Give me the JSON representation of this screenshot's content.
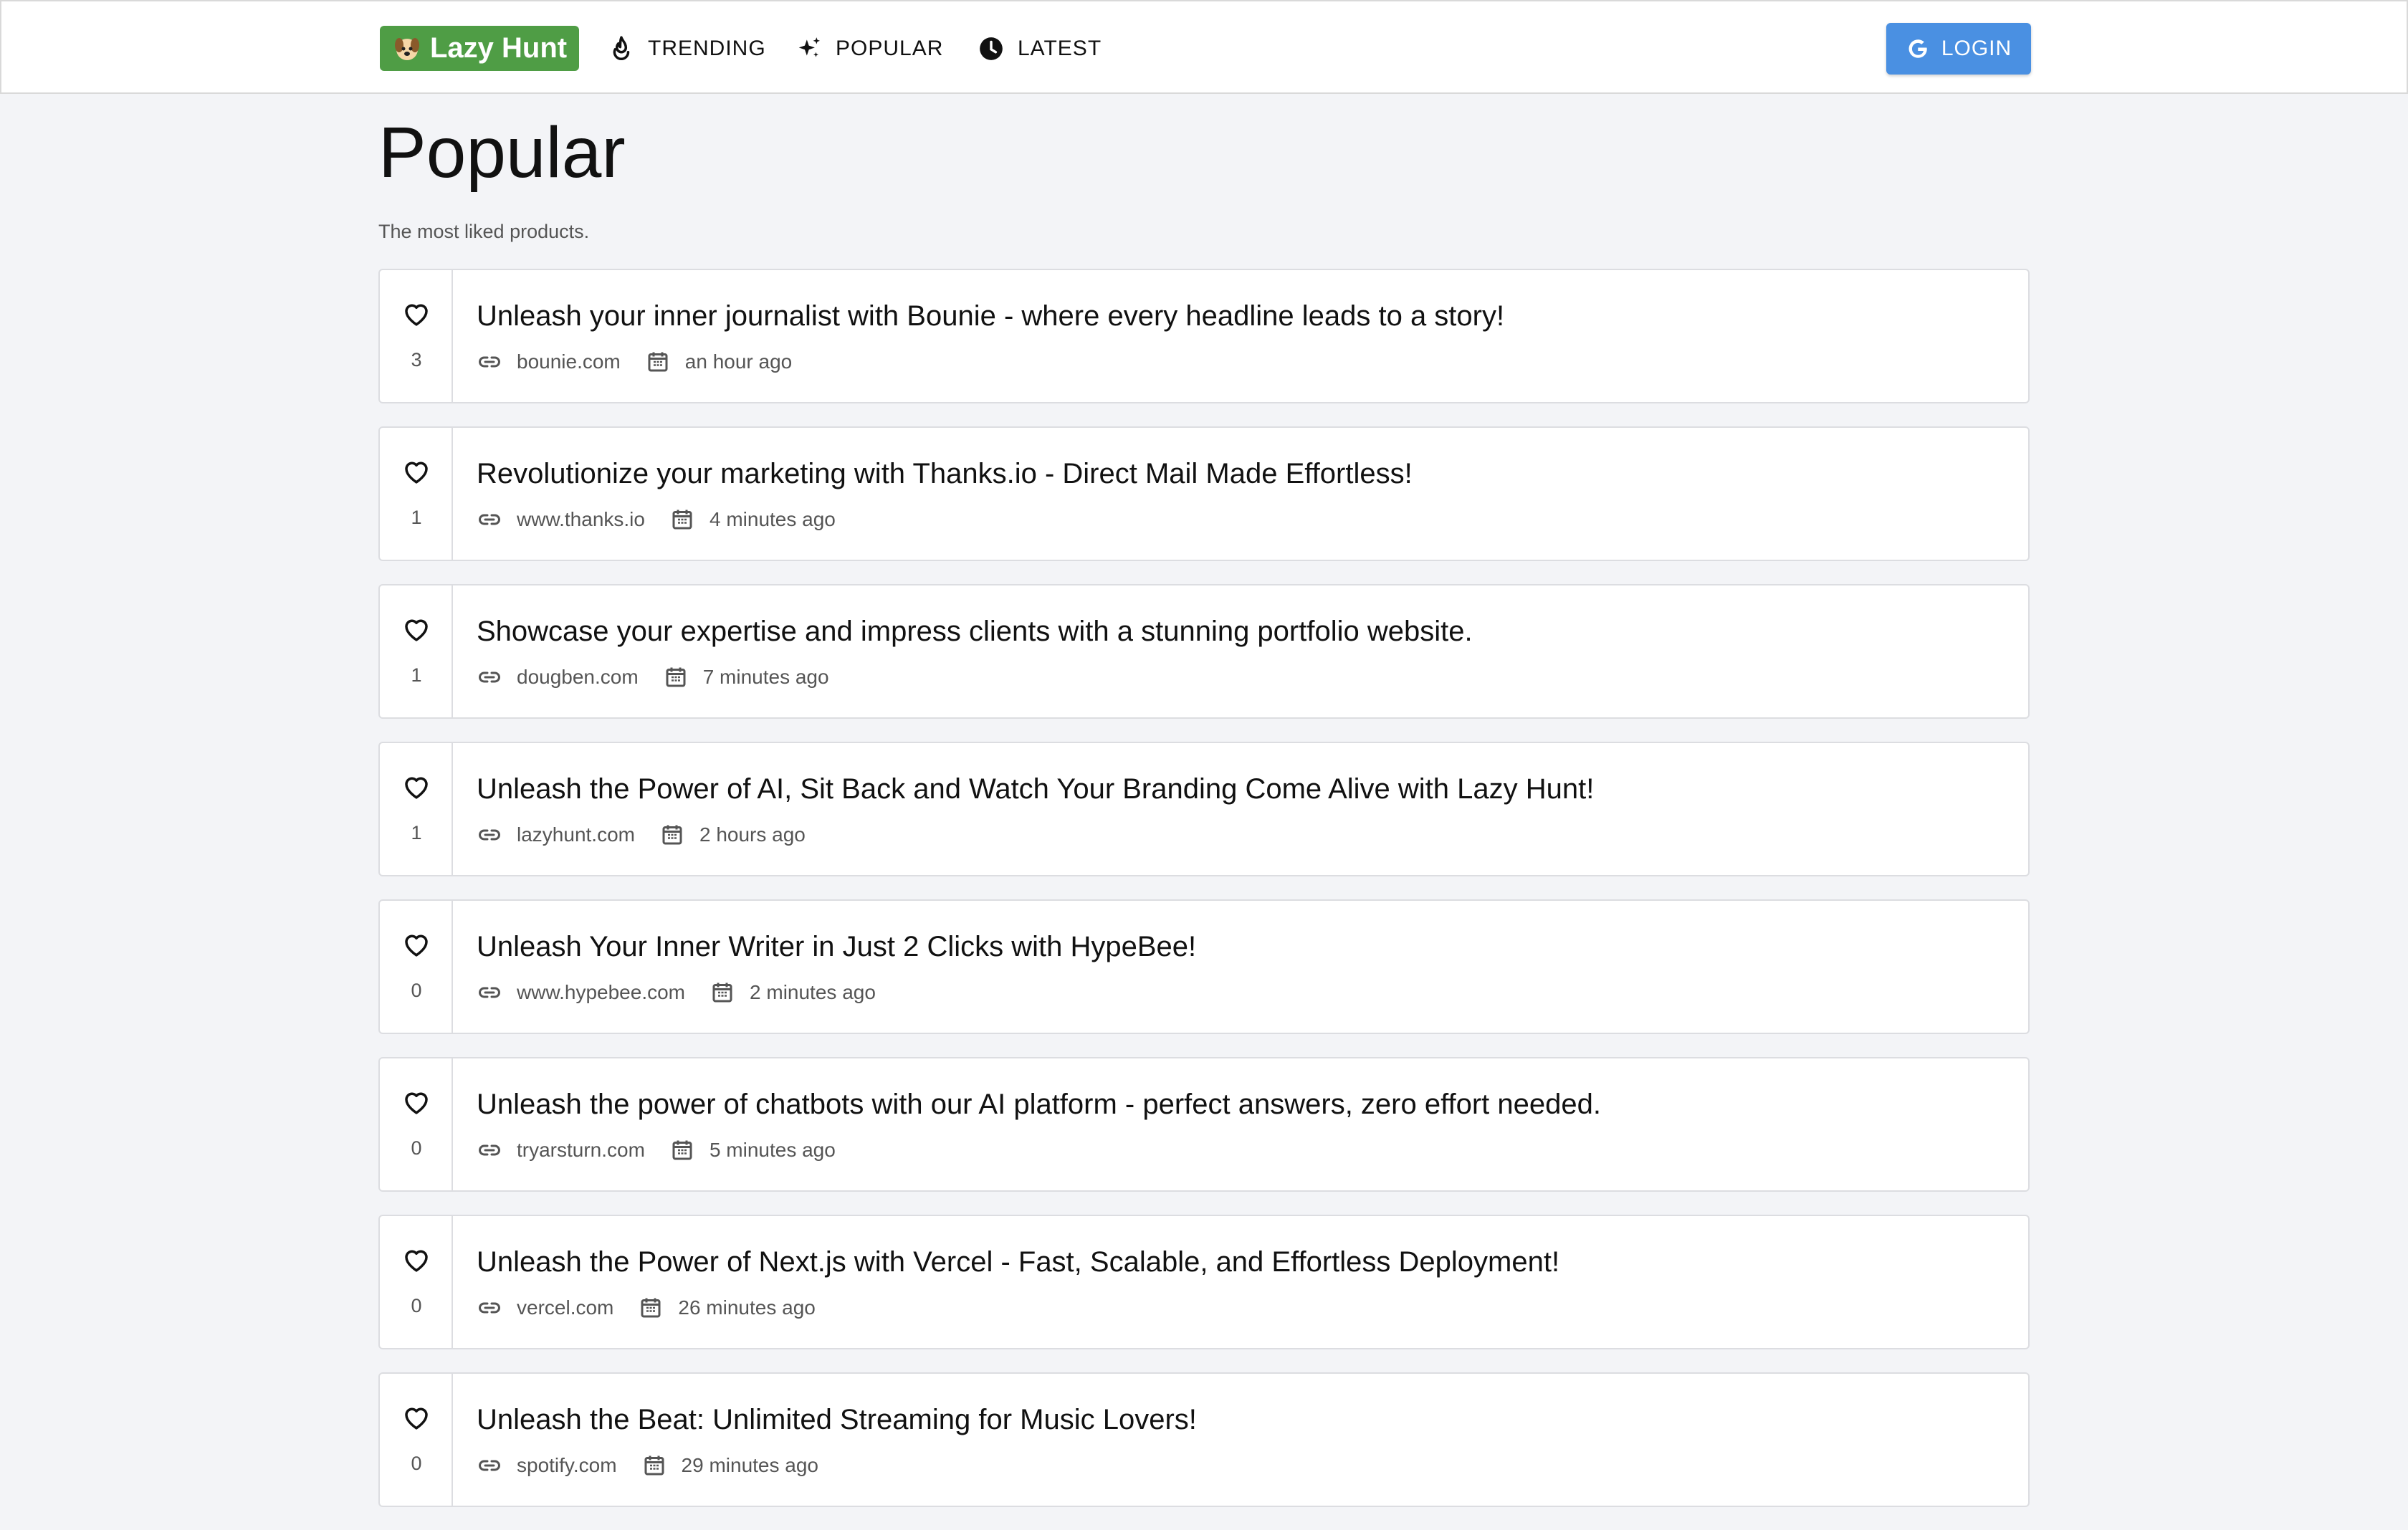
{
  "header": {
    "logo_text": "Lazy Hunt",
    "nav": [
      {
        "label": "TRENDING",
        "icon": "fire-icon"
      },
      {
        "label": "POPULAR",
        "icon": "sparkles-icon"
      },
      {
        "label": "LATEST",
        "icon": "clock-icon"
      }
    ],
    "login_label": "LOGIN",
    "login_icon": "google-icon"
  },
  "main": {
    "title": "Popular",
    "subtitle": "The most liked products."
  },
  "products": [
    {
      "votes": "3",
      "title": "Unleash your inner journalist with Bounie - where every headline leads to a story!",
      "domain": "bounie.com",
      "time": "an hour ago"
    },
    {
      "votes": "1",
      "title": "Revolutionize your marketing with Thanks.io - Direct Mail Made Effortless!",
      "domain": "www.thanks.io",
      "time": "4 minutes ago"
    },
    {
      "votes": "1",
      "title": "Showcase your expertise and impress clients with a stunning portfolio website.",
      "domain": "dougben.com",
      "time": "7 minutes ago"
    },
    {
      "votes": "1",
      "title": "Unleash the Power of AI, Sit Back and Watch Your Branding Come Alive with Lazy Hunt!",
      "domain": "lazyhunt.com",
      "time": "2 hours ago"
    },
    {
      "votes": "0",
      "title": "Unleash Your Inner Writer in Just 2 Clicks with HypeBee!",
      "domain": "www.hypebee.com",
      "time": "2 minutes ago"
    },
    {
      "votes": "0",
      "title": "Unleash the power of chatbots with our AI platform - perfect answers, zero effort needed.",
      "domain": "tryarsturn.com",
      "time": "5 minutes ago"
    },
    {
      "votes": "0",
      "title": "Unleash the Power of Next.js with Vercel - Fast, Scalable, and Effortless Deployment!",
      "domain": "vercel.com",
      "time": "26 minutes ago"
    },
    {
      "votes": "0",
      "title": "Unleash the Beat: Unlimited Streaming for Music Lovers!",
      "domain": "spotify.com",
      "time": "29 minutes ago"
    }
  ],
  "colors": {
    "logo_bg": "#4f9d45",
    "login_bg": "#4a90e2",
    "page_bg": "#f3f4f7"
  }
}
